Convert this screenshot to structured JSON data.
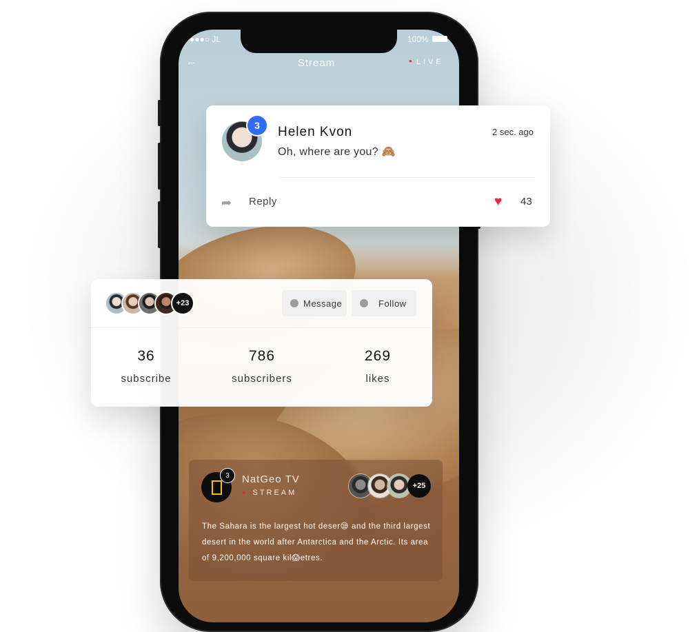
{
  "status_bar": {
    "carrier": "JL",
    "battery": "100%"
  },
  "nav": {
    "back_icon": "arrow-left-icon",
    "title": "Stream",
    "live_label": "LIVE"
  },
  "comment": {
    "badge": "3",
    "author": "Helen Kvon",
    "time": "2 sec. ago",
    "text": "Oh, where are you? 🙈",
    "reply_label": "Reply",
    "likes": "43",
    "colors": {
      "badge": "#2f6df6",
      "heart": "#e22b3e"
    }
  },
  "profile_stats": {
    "followers_more": "+23",
    "message_label": "Message",
    "follow_label": "Follow",
    "stats": [
      {
        "value": "36",
        "label": "subscribe"
      },
      {
        "value": "786",
        "label": "subscribers"
      },
      {
        "value": "269",
        "label": "likes"
      }
    ]
  },
  "channel": {
    "name": "NatGeo TV",
    "badge": "3",
    "status": "STREAM",
    "viewers_more": "+25",
    "description": "The Sahara is the largest hot deser😪        and the third largest desert in the world after Antarctica and the Arctic. Its area of 9,200,000 square kil😱etres.",
    "logo_color": "#f3c400"
  }
}
